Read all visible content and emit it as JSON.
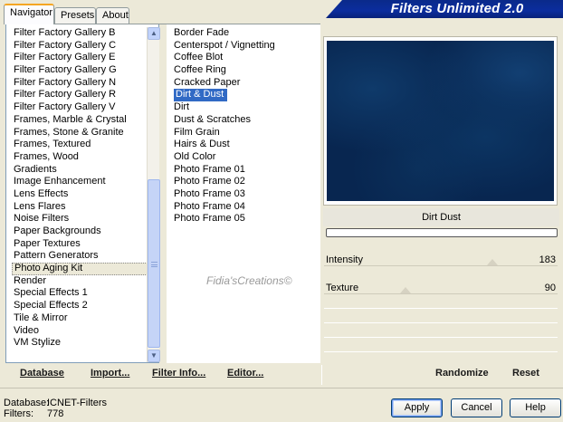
{
  "app": {
    "title": "Filters Unlimited 2.0",
    "watermark": "Fidia'sCreations©"
  },
  "tabs": [
    {
      "label": "Navigator",
      "active": true
    },
    {
      "label": "Presets",
      "active": false
    },
    {
      "label": "About",
      "active": false
    }
  ],
  "categories": {
    "selected": "Photo Aging Kit",
    "items": [
      "Filter Factory Gallery B",
      "Filter Factory Gallery C",
      "Filter Factory Gallery E",
      "Filter Factory Gallery G",
      "Filter Factory Gallery N",
      "Filter Factory Gallery R",
      "Filter Factory Gallery V",
      "Frames, Marble & Crystal",
      "Frames, Stone & Granite",
      "Frames, Textured",
      "Frames, Wood",
      "Gradients",
      "Image Enhancement",
      "Lens Effects",
      "Lens Flares",
      "Noise Filters",
      "Paper Backgrounds",
      "Paper Textures",
      "Pattern Generators",
      "Photo Aging Kit",
      "Render",
      "Special Effects 1",
      "Special Effects 2",
      "Tile & Mirror",
      "Video",
      "VM Stylize"
    ]
  },
  "filters": {
    "selected": "Dirt & Dust",
    "items": [
      "Border Fade",
      "Centerspot / Vignetting",
      "Coffee Blot",
      "Coffee Ring",
      "Cracked Paper",
      "Dirt & Dust",
      "Dirt",
      "Dust & Scratches",
      "Film Grain",
      "Hairs & Dust",
      "Old Color",
      "Photo Frame 01",
      "Photo Frame 02",
      "Photo Frame 03",
      "Photo Frame 04",
      "Photo Frame 05"
    ]
  },
  "preview": {
    "effect_name": "Dirt  Dust",
    "colors": {
      "base": "#082650"
    }
  },
  "parameters": [
    {
      "label": "Intensity",
      "value": "183",
      "level": 0.72
    },
    {
      "label": "Texture",
      "value": "90",
      "level": 0.35
    }
  ],
  "toolbar": {
    "database": "Database",
    "import": "Import...",
    "filter_info": "Filter Info...",
    "editor": "Editor...",
    "randomize": "Randomize",
    "reset": "Reset"
  },
  "status": {
    "database_label": "Database:",
    "database_value": "ICNET-Filters",
    "filters_label": "Filters:",
    "filters_value": "778"
  },
  "buttons": {
    "apply": "Apply",
    "cancel": "Cancel",
    "help": "Help"
  }
}
